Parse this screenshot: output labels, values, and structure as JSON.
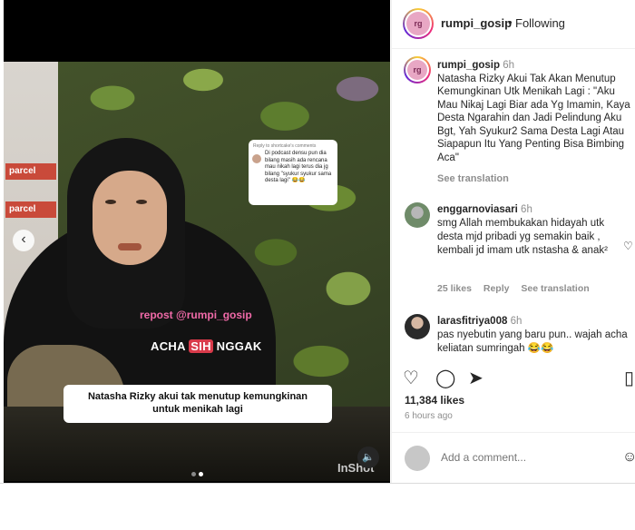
{
  "header": {
    "username": "rumpi_gosip",
    "separator": "•",
    "follow_status": "Following",
    "avatar_label": "rg"
  },
  "media": {
    "signs": [
      "parcel",
      "parcel"
    ],
    "reply_card": {
      "head": "Reply to shortcake's comments",
      "text": "Di podcast densu pun dia bilang masih ada rencana mau nikah lagi terus dia jg bilang \"syukur syukur sama desta lagi\" 😂😂"
    },
    "repost": "repost @rumpi_gosip",
    "acha_pre": "ACHA ",
    "acha_hl": "SIH",
    "acha_post": " NGGAK",
    "caption_line1": "Natasha Rizky akui tak menutup kemungkinan",
    "caption_line2": "untuk menikah lagi",
    "nav_prev": "‹",
    "sound_icon": "🔈",
    "watermark": "InShot",
    "slide_count": 2,
    "active_slide": 2
  },
  "caption": {
    "username": "rumpi_gosip",
    "time": "6h",
    "text": "Natasha Rizky Akui Tak Akan Menutup Kemungkinan Utk Menikah Lagi : \"Aku Mau Nikaj Lagi Biar ada Yg Imamin, Kaya Desta Ngarahin dan Jadi Pelindung Aku Bgt, Yah Syukur2 Sama Desta Lagi Atau Siapapun Itu Yang Penting Bisa Bimbing Aca\"",
    "see_translation": "See translation"
  },
  "comments": [
    {
      "username": "enggarnoviasari",
      "time": "6h",
      "text": "smg Allah membukakan hidayah utk desta mjd pribadi yg semakin baik , kembali jd imam utk nstasha & anak²",
      "likes": "25 likes",
      "reply": "Reply",
      "see_translation": "See translation"
    },
    {
      "username": "larasfitriya008",
      "time": "6h",
      "text": "pas nyebutin yang baru pun.. wajah acha keliatan sumringah 😂😂"
    }
  ],
  "actions": {
    "like_icon": "♡",
    "comment_icon": "◯",
    "share_icon": "➤",
    "save_icon": "▯"
  },
  "likes": "11,384 likes",
  "posted_ago": "6 hours ago",
  "add_comment": {
    "placeholder": "Add a comment...",
    "emoji_icon": "☺"
  },
  "comment_heart_icon": "♡"
}
